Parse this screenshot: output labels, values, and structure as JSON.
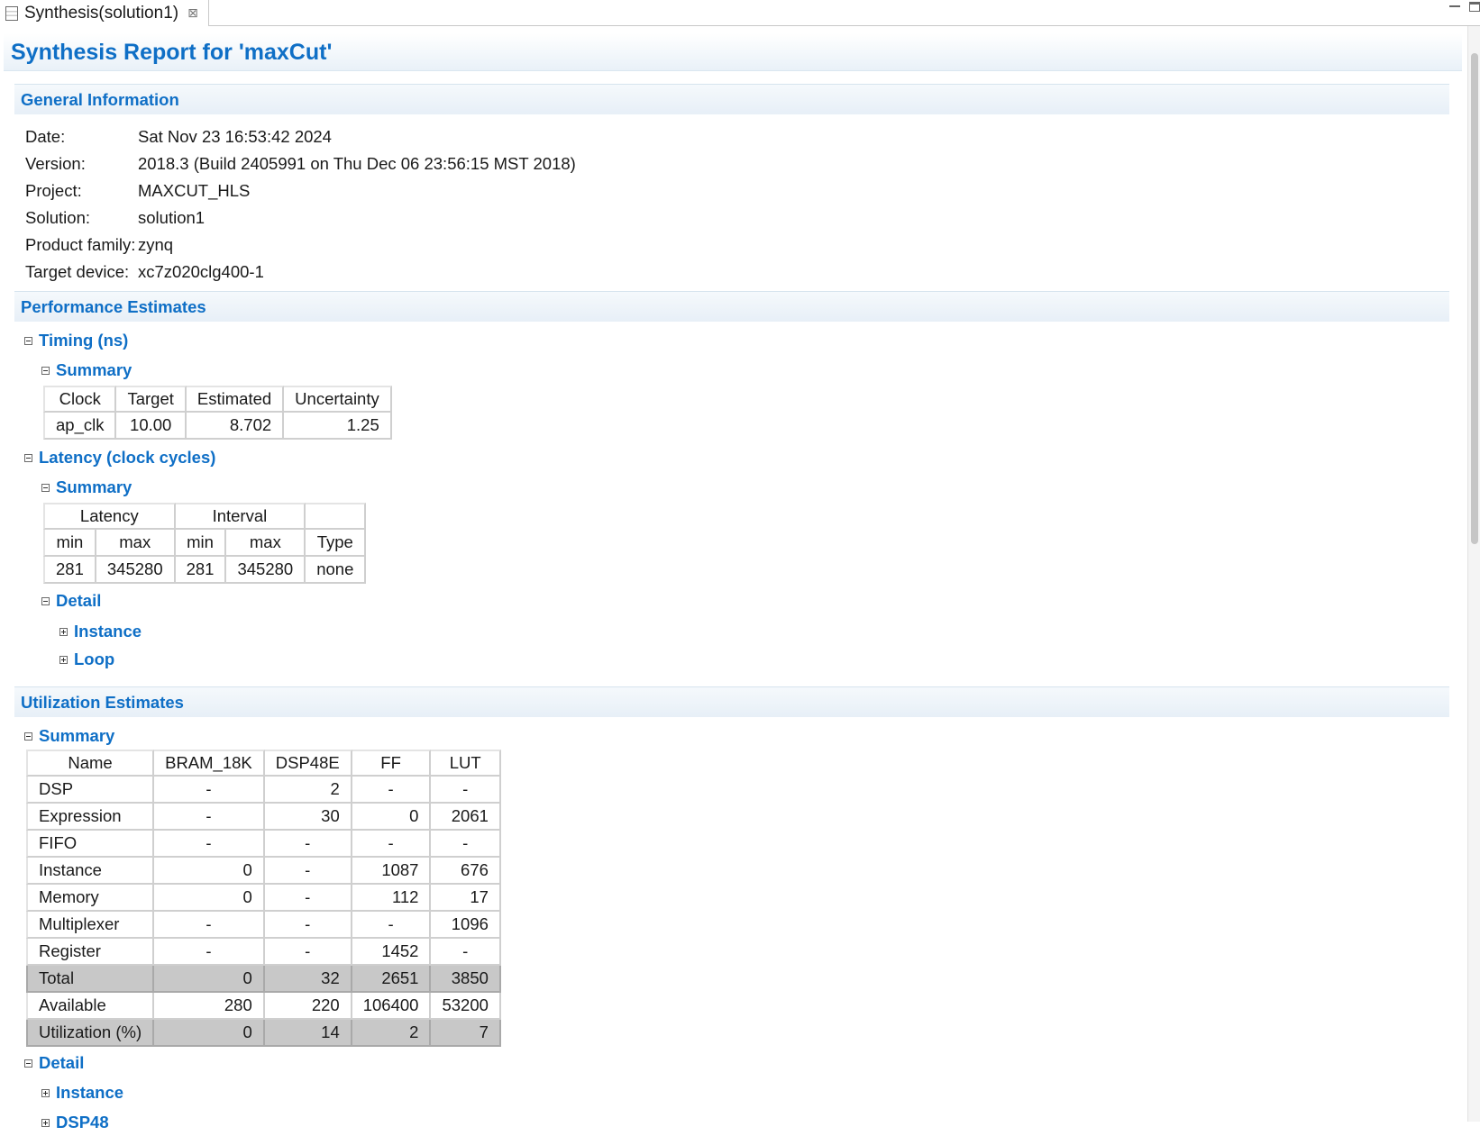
{
  "editor_tab": {
    "title": "Synthesis(solution1)",
    "close_glyph": "⊠"
  },
  "page": {
    "title": "Synthesis Report for 'maxCut'"
  },
  "general": {
    "header": "General Information",
    "rows": [
      {
        "key": "Date:",
        "value": "Sat Nov 23 16:53:42 2024"
      },
      {
        "key": "Version:",
        "value": "2018.3 (Build 2405991 on Thu Dec 06 23:56:15 MST 2018)"
      },
      {
        "key": "Project:",
        "value": "MAXCUT_HLS"
      },
      {
        "key": "Solution:",
        "value": "solution1"
      },
      {
        "key": "Product family:",
        "value": "zynq"
      },
      {
        "key": "Target device:",
        "value": "xc7z020clg400-1"
      }
    ]
  },
  "performance": {
    "header": "Performance Estimates",
    "timing": {
      "label": "Timing (ns)",
      "summary_label": "Summary",
      "headers": [
        "Clock",
        "Target",
        "Estimated",
        "Uncertainty"
      ],
      "row": [
        "ap_clk",
        "10.00",
        "8.702",
        "1.25"
      ]
    },
    "latency": {
      "label": "Latency (clock cycles)",
      "summary_label": "Summary",
      "group_headers": [
        "Latency",
        "Interval"
      ],
      "sub_headers": [
        "min",
        "max",
        "min",
        "max",
        "Type"
      ],
      "row": [
        "281",
        "345280",
        "281",
        "345280",
        "none"
      ],
      "detail_label": "Detail",
      "detail_items": [
        "Instance",
        "Loop"
      ]
    }
  },
  "utilization": {
    "header": "Utilization Estimates",
    "summary_label": "Summary",
    "headers": [
      "Name",
      "BRAM_18K",
      "DSP48E",
      "FF",
      "LUT"
    ],
    "rows": [
      [
        "DSP",
        "-",
        "2",
        "-",
        "-"
      ],
      [
        "Expression",
        "-",
        "30",
        "0",
        "2061"
      ],
      [
        "FIFO",
        "-",
        "-",
        "-",
        "-"
      ],
      [
        "Instance",
        "0",
        "-",
        "1087",
        "676"
      ],
      [
        "Memory",
        "0",
        "-",
        "112",
        "17"
      ],
      [
        "Multiplexer",
        "-",
        "-",
        "-",
        "1096"
      ],
      [
        "Register",
        "-",
        "-",
        "1452",
        "-"
      ],
      [
        "Total",
        "0",
        "32",
        "2651",
        "3850"
      ],
      [
        "Available",
        "280",
        "220",
        "106400",
        "53200"
      ],
      [
        "Utilization (%)",
        "0",
        "14",
        "2",
        "7"
      ]
    ],
    "detail_label": "Detail",
    "detail_items": [
      "Instance",
      "DSP48"
    ]
  },
  "colors": {
    "link_blue": "#0f6fc6",
    "shade_gray": "#c8c8c8"
  }
}
